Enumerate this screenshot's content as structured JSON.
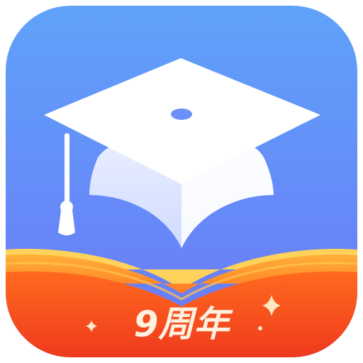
{
  "app_icon": {
    "badge_text": "9周年",
    "colors": {
      "background_top": "#5E9BFA",
      "background_bottom": "#6C7CF7",
      "cap": "#FFFFFF",
      "cap_shade": "#DCE5FF",
      "book_orange": "#FF8A22",
      "book_red": "#F23D1E",
      "book_highlight": "#FFD15A",
      "sparkle": "#FFE8C8"
    },
    "icons": [
      "graduation-cap-icon",
      "open-book-icon",
      "sparkle-icon"
    ]
  }
}
